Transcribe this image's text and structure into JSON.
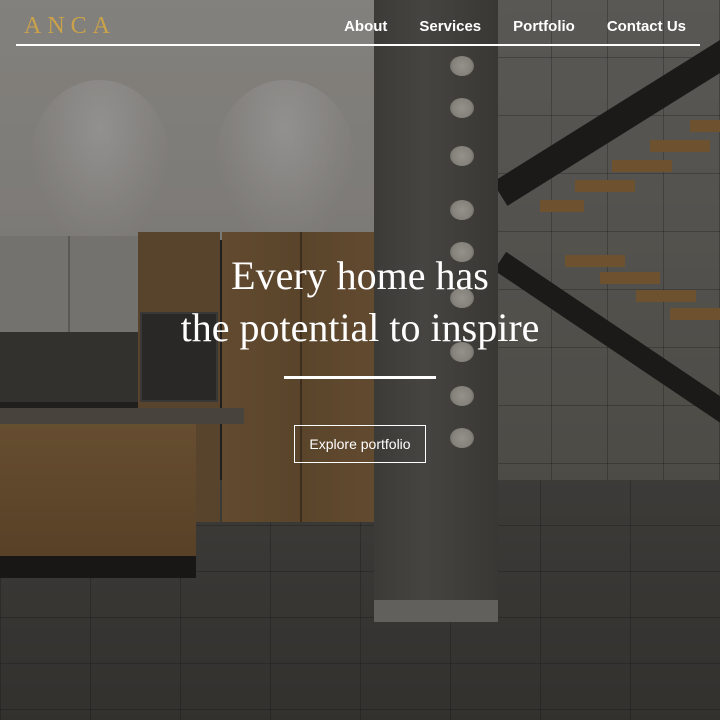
{
  "brand": {
    "logo_text": "ANCA",
    "logo_color": "#c9a24a"
  },
  "nav": {
    "items": [
      {
        "label": "About"
      },
      {
        "label": "Services"
      },
      {
        "label": "Portfolio"
      },
      {
        "label": "Contact Us"
      }
    ]
  },
  "hero": {
    "headline_line1": "Every home has",
    "headline_line2": "the potential to inspire",
    "cta_label": "Explore portfolio"
  },
  "colors": {
    "text": "#ffffff",
    "accent": "#c9a24a",
    "overlay": "rgba(18,17,15,0.42)"
  }
}
